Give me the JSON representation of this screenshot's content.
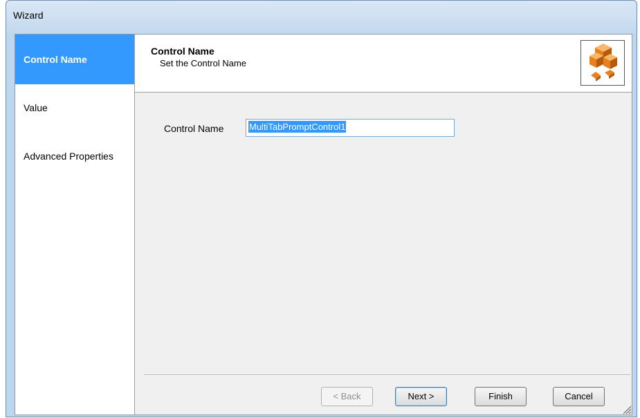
{
  "window": {
    "title": "Wizard"
  },
  "sidebar": {
    "items": [
      {
        "label": "Control Name",
        "selected": true
      },
      {
        "label": "Value",
        "selected": false
      },
      {
        "label": "Advanced Properties",
        "selected": false
      }
    ]
  },
  "header": {
    "title": "Control Name",
    "subtitle": "Set the Control Name",
    "icon": "orange-cubes-icon"
  },
  "form": {
    "control_name_label": "Control Name",
    "control_name_value": "MultiTabPromptControl1"
  },
  "buttons": {
    "back": "< Back",
    "next": "Next >",
    "finish": "Finish",
    "cancel": "Cancel"
  },
  "colors": {
    "selection": "#3399ff",
    "icon_orange": "#e8801c"
  }
}
